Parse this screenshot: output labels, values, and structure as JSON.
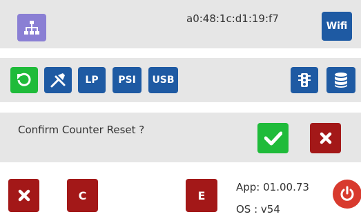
{
  "header": {
    "mac_address": "a0:48:1c:d1:19:f7",
    "wifi_label": "Wifi",
    "network_icon": "network-tree-icon"
  },
  "toolbar": {
    "refresh_icon": "refresh-icon",
    "tools_icon": "tools-icon",
    "lp_label": "LP",
    "psi_label": "PSI",
    "usb_label": "USB",
    "traffic_icon": "traffic-light-icon",
    "database_icon": "database-icon"
  },
  "confirm": {
    "message": "Confirm Counter Reset ?",
    "ok_icon": "check-icon",
    "cancel_icon": "close-icon"
  },
  "footer": {
    "x_icon": "close-icon",
    "c_label": "C",
    "e_label": "E",
    "app_version": "App: 01.00.73",
    "os_version": "OS : v54",
    "power_icon": "power-icon"
  },
  "colors": {
    "blue": "#1e5aa3",
    "purple": "#8a7fd4",
    "green": "#1fbb3a",
    "red": "#a31818",
    "power_red": "#d83a2e",
    "bar_gray": "#e6e6e6"
  }
}
